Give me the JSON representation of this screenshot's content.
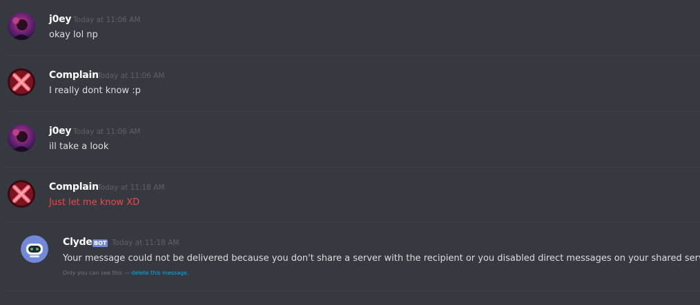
{
  "messages": [
    {
      "author": "j0ey",
      "timestamp": "Today at 11:06 AM",
      "text": "okay lol np",
      "avatar_icon": "purple-user-avatar"
    },
    {
      "author": "Complain",
      "timestamp": "Today at 11:06 AM",
      "text": "I really dont know :p",
      "avatar_icon": "red-x-avatar"
    },
    {
      "author": "j0ey",
      "timestamp": "Today at 11:06 AM",
      "text": "ill take a look",
      "avatar_icon": "purple-user-avatar"
    },
    {
      "author": "Complain",
      "timestamp": "Today at 11:18 AM",
      "text": "Just let me know XD",
      "text_color": "#f04747",
      "avatar_icon": "red-x-avatar"
    }
  ],
  "bot_message": {
    "author": "Clyde",
    "tag": "BOT",
    "timestamp": "Today at 11:18 AM",
    "text": "Your message could not be delivered because you don't share a server with the recipient or you disabled direct messages on your shared server, recipient",
    "ephemeral_prefix": "Only you can see this — ",
    "ephemeral_link": "delete this message.",
    "avatar_icon": "clyde-robot-avatar"
  },
  "colors": {
    "background": "#36393f",
    "bot_tag": "#7289da",
    "error_text": "#f04747",
    "link": "#00b0f4"
  }
}
